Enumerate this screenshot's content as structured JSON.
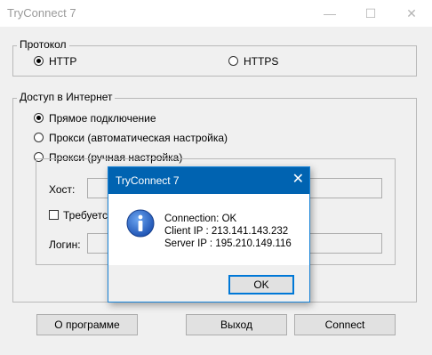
{
  "window": {
    "title": "TryConnect 7",
    "minimize": "—",
    "maximize": "☐",
    "close": "✕"
  },
  "protocol": {
    "legend": "Протокол",
    "options": [
      {
        "label": "HTTP",
        "selected": true
      },
      {
        "label": "HTTPS",
        "selected": false
      }
    ]
  },
  "internet": {
    "legend": "Доступ в Интернет",
    "options": [
      {
        "label": "Прямое подключение",
        "selected": true
      },
      {
        "label": "Прокси (автоматическая настройка)",
        "selected": false
      },
      {
        "label": "Прокси (ручная настройка)",
        "selected": false
      }
    ],
    "host_label": "Хост:",
    "auth_label": "Требуется",
    "login_label": "Логин:"
  },
  "buttons": {
    "about": "О программе",
    "exit": "Выход",
    "connect": "Connect"
  },
  "dialog": {
    "title": "TryConnect 7",
    "close": "✕",
    "lines": [
      "Connection: OK",
      "Client IP : 213.141.143.232",
      "Server IP : 195.210.149.116"
    ],
    "ok": "OK",
    "icon": "info-icon"
  },
  "colors": {
    "dialog_title_bg": "#0063b1",
    "accent": "#0078d7",
    "info_icon": "#1c5bbf"
  }
}
